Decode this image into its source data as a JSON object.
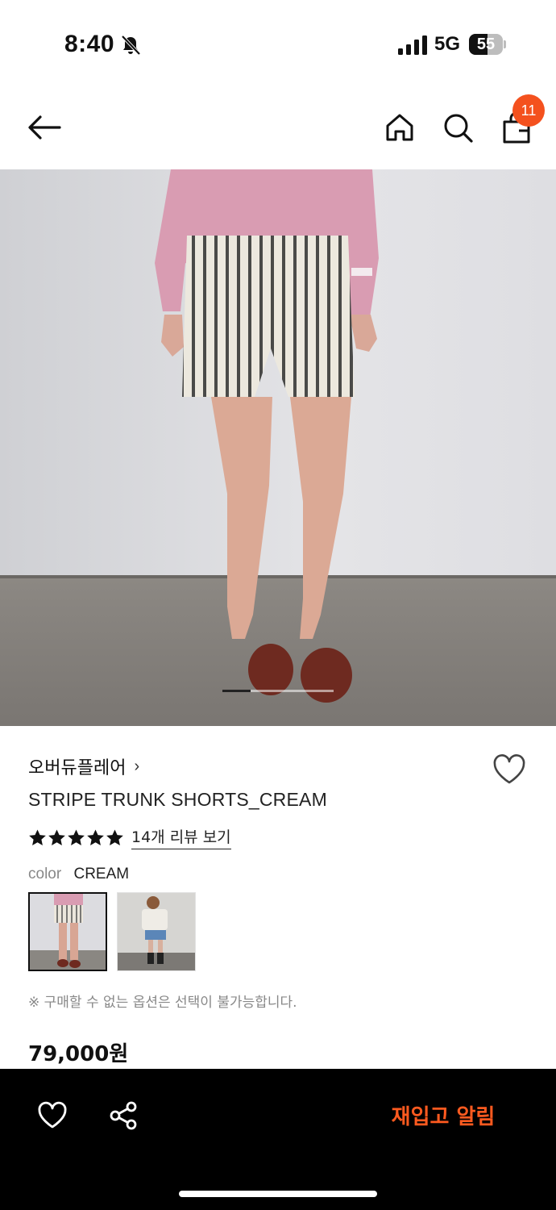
{
  "status_bar": {
    "time": "8:40",
    "network": "5G",
    "battery_level": "55",
    "battery_fraction": 0.55
  },
  "nav": {
    "icons": [
      "back-arrow-icon",
      "home-icon",
      "search-icon",
      "shopping-bag-icon"
    ],
    "cart_count": "11"
  },
  "product": {
    "image_slide": {
      "current": 1,
      "fraction": 0.25
    },
    "brand": "오버듀플레어",
    "brand_chevron": "›",
    "title": "STRIPE TRUNK SHORTS_CREAM",
    "rating_stars": 5,
    "review_link": "14개 리뷰 보기",
    "color_label": "color",
    "color_value": "CREAM",
    "notice": "※ 구매할 수 없는 옵션은 선택이 불가능합니다.",
    "price": "79,000원"
  },
  "bottom_bar": {
    "restock_label": "재입고 알림",
    "icons": [
      "heart-icon",
      "share-icon"
    ]
  },
  "colors": {
    "accent": "#ff5a1f",
    "badge": "#f4511e",
    "bottom_bar_bg": "#000000"
  }
}
